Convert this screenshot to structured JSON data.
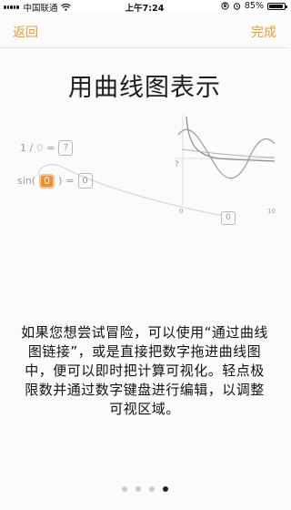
{
  "status_bar": {
    "carrier": "中国联通",
    "time": "上午7:24",
    "battery": "85%",
    "battery_level": 0.85
  },
  "nav": {
    "back_label": "返回",
    "done_label": "完成"
  },
  "title": "用曲线图表示",
  "illustration": {
    "expr1_left": "1 /",
    "expr1_zero": "0",
    "expr1_eq": "=",
    "expr1_result": "?",
    "expr2_fn": "sin(",
    "expr2_arg": "0",
    "expr2_close": ")",
    "expr2_eq": "=",
    "expr2_result": "0",
    "graph_ytick": "?",
    "graph_xmin": "0",
    "graph_xmax": "10",
    "graph_value": "0"
  },
  "description": "如果您想尝试冒险，可以使用“通过曲线图链接”，或是直接把数字拖进曲线图中，便可以即时把计算可视化。轻点极限数并通过数字键盘进行编辑，以调整可视区域。",
  "pagination": {
    "total": 4,
    "current": 4
  },
  "colors": {
    "accent": "#f19a2c",
    "orange_box": "#ef8f2a"
  }
}
